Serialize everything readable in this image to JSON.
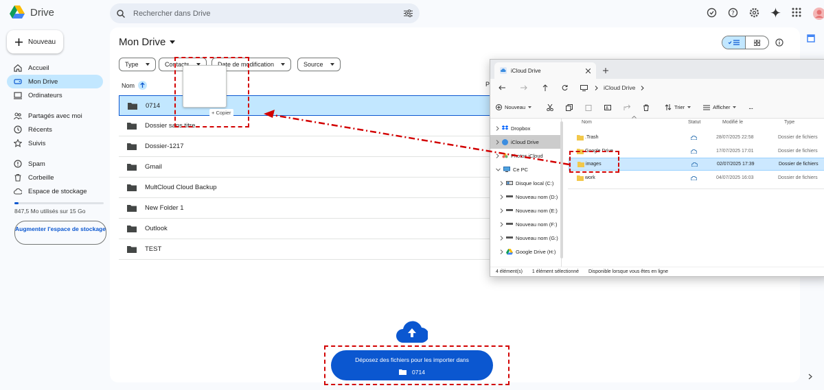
{
  "app": {
    "name": "Drive"
  },
  "search": {
    "placeholder": "Rechercher dans Drive"
  },
  "sidebar": {
    "new_label": "Nouveau",
    "items": [
      {
        "label": "Accueil",
        "icon": "home-icon"
      },
      {
        "label": "Mon Drive",
        "icon": "drive-icon"
      },
      {
        "label": "Ordinateurs",
        "icon": "computer-icon"
      },
      {
        "label": "Partagés avec moi",
        "icon": "people-icon"
      },
      {
        "label": "Récents",
        "icon": "clock-icon"
      },
      {
        "label": "Suivis",
        "icon": "star-icon"
      },
      {
        "label": "Spam",
        "icon": "spam-icon"
      },
      {
        "label": "Corbeille",
        "icon": "trash-icon"
      },
      {
        "label": "Espace de stockage",
        "icon": "cloud-icon"
      }
    ],
    "quota_text": "847,5 Mo utilisés sur 15 Go",
    "upgrade_label": "Augmenter l'espace de stockage"
  },
  "main": {
    "title": "Mon Drive",
    "filters": [
      "Type",
      "Contacts",
      "Date de modification",
      "Source"
    ],
    "col_name": "Nom",
    "files": [
      "0714",
      "Dossier sans titre",
      "Dossier-1217",
      "Gmail",
      "MultCloud Cloud Backup",
      "New Folder 1",
      "Outlook",
      "TEST"
    ]
  },
  "drag": {
    "copy_label": "+ Copier"
  },
  "upload": {
    "line1": "Déposez des fichiers pour les importer dans",
    "folder": "0714"
  },
  "explorer": {
    "tab_title": "iCloud Drive",
    "address": "iCloud Drive",
    "toolbar": {
      "new": "Nouveau",
      "sort": "Trier",
      "view": "Afficher",
      "more": "..."
    },
    "nav": [
      {
        "label": "Dropbox",
        "icon": "dropbox-icon"
      },
      {
        "label": "iCloud Drive",
        "icon": "icloud-icon"
      },
      {
        "label": "Photos iCloud",
        "icon": "photos-icon"
      },
      {
        "label": "Ce PC",
        "icon": "pc-icon"
      },
      {
        "label": "Disque local (C:)",
        "icon": "disk-icon"
      },
      {
        "label": "Nouveau nom (D:)",
        "icon": "disk-icon"
      },
      {
        "label": "Nouveau nom (E:)",
        "icon": "disk-icon"
      },
      {
        "label": "Nouveau nom (F:)",
        "icon": "disk-icon"
      },
      {
        "label": "Nouveau nom (G:)",
        "icon": "disk-icon"
      },
      {
        "label": "Google Drive (H:)",
        "icon": "gdrive-icon"
      }
    ],
    "columns": {
      "name": "Nom",
      "status": "Statut",
      "modified": "Modifié le",
      "type": "Type"
    },
    "rows": [
      {
        "name": ".Trash",
        "date": "28/07/2025 22:58",
        "type": "Dossier de fichiers"
      },
      {
        "name": "Google Drive",
        "date": "17/07/2025 17:01",
        "type": "Dossier de fichiers"
      },
      {
        "name": "images",
        "date": "02/07/2025 17:39",
        "type": "Dossier de fichiers"
      },
      {
        "name": "work",
        "date": "04/07/2025 16:03",
        "type": "Dossier de fichiers"
      }
    ],
    "status": {
      "count": "4 élément(s)",
      "selected": "1 élément sélectionné",
      "availability": "Disponible lorsque vous êtes en ligne"
    }
  },
  "colors": {
    "accent": "#0b57d0",
    "selection": "#c2e7ff",
    "annotation": "#d20000"
  }
}
